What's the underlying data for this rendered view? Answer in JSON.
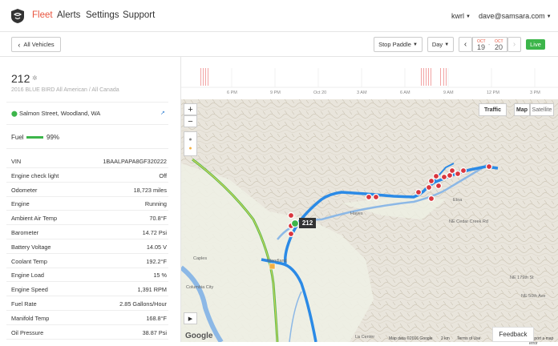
{
  "nav": {
    "items": [
      "Fleet",
      "Alerts",
      "Settings",
      "Support"
    ],
    "org": "kwrl",
    "user": "dave@samsara.com"
  },
  "toolbar": {
    "back_label": "All Vehicles",
    "stop_label": "Stop Paddle",
    "period_label": "Day",
    "start_month": "OCT",
    "start_day": "19",
    "end_month": "OCT",
    "end_day": "20",
    "date_sep": "-",
    "live_label": "Live"
  },
  "vehicle": {
    "name": "212",
    "subtitle": "2016 BLUE BIRD All American / All Canada",
    "location": "Salmon Street, Woodland, WA",
    "fuel_label": "Fuel",
    "fuel_value": "99%",
    "fuel_level": 0.99,
    "stats": [
      {
        "k": "VIN",
        "v": "1BAALPAPA8GF320222"
      },
      {
        "k": "Engine check light",
        "v": "Off"
      },
      {
        "k": "Odometer",
        "v": "18,723 miles"
      },
      {
        "k": "Engine",
        "v": "Running"
      },
      {
        "k": "Ambient Air Temp",
        "v": "70.8°F"
      },
      {
        "k": "Barometer",
        "v": "14.72 Psi"
      },
      {
        "k": "Battery Voltage",
        "v": "14.05 V"
      },
      {
        "k": "Coolant Temp",
        "v": "192.2°F"
      },
      {
        "k": "Engine Load",
        "v": "15 %"
      },
      {
        "k": "Engine Speed",
        "v": "1,391 RPM"
      },
      {
        "k": "Fuel Rate",
        "v": "2.85 Gallons/Hour"
      },
      {
        "k": "Manifold Temp",
        "v": "168.8°F"
      },
      {
        "k": "Oil Pressure",
        "v": "38.87 Psi"
      }
    ]
  },
  "timeline": {
    "ticks": [
      "6 PM",
      "9 PM",
      "Oct 20",
      "3 AM",
      "6 AM",
      "9 AM",
      "12 PM",
      "3 PM"
    ]
  },
  "map": {
    "traffic_label": "Traffic",
    "map_label": "Map",
    "satellite_label": "Satellite",
    "zoom_in": "+",
    "zoom_out": "−",
    "vehicle_tag": "212",
    "places": [
      "Hayes",
      "Caples",
      "Columbia City",
      "La Center",
      "Etna",
      "NE 179th St",
      "NE Cedar Creek Rd",
      "NE 50th Ave",
      "Woodland"
    ],
    "attribution": "Map data ©2016 Google",
    "scale": "2 km",
    "terms": "Terms of Use",
    "report": "Report a map error",
    "google": "Google",
    "feedback_label": "Feedback",
    "colors": {
      "route": "#2b8ae6",
      "stop": "#d9363e",
      "highway": "#5bbf4e",
      "river": "#7fb3e8"
    }
  }
}
